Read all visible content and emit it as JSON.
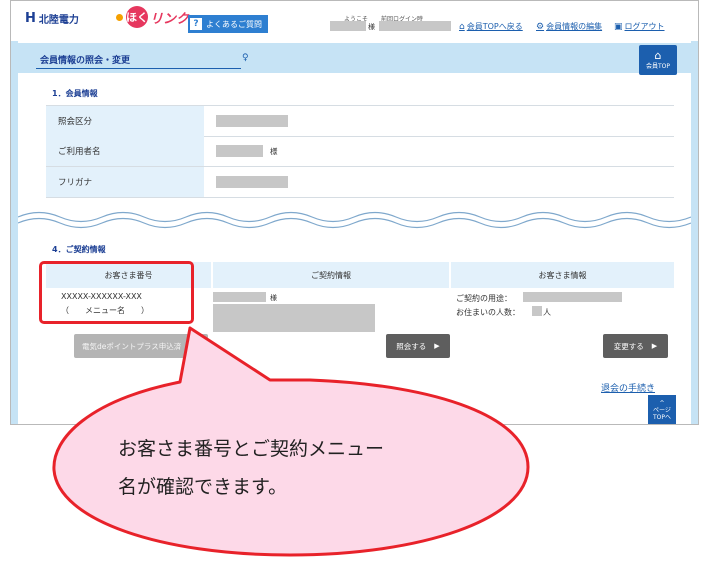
{
  "header": {
    "logo_mark": "H",
    "company": "北陸電力",
    "brand_circle": "ほく",
    "brand_text": "リンク",
    "faq_icon": "?",
    "faq_label": "よくあるご質問",
    "welcome_label": "ようこそ",
    "sama": "様",
    "prev_login_label": "前回ログイン時",
    "nav": [
      {
        "label": "会員TOPへ戻る",
        "icon": "home-icon"
      },
      {
        "label": "会員情報の編集",
        "icon": "gear-icon"
      },
      {
        "label": "ログアウト",
        "icon": "logout-icon"
      }
    ]
  },
  "titlebar": {
    "title": "会員情報の照会・変更",
    "top_button": "会員TOP"
  },
  "section1": {
    "heading": "1．会員情報",
    "rows": [
      {
        "label": "照会区分",
        "suffix": ""
      },
      {
        "label": "ご利用者名",
        "suffix": "様"
      },
      {
        "label": "フリガナ",
        "suffix": ""
      }
    ]
  },
  "section4": {
    "heading": "4．ご契約情報",
    "columns": [
      "お客さま番号",
      "ご契約情報",
      "お客さま情報"
    ],
    "customer_number": "XXXXX-XXXXXX-XXX",
    "menu_name": "（　　メニュー名　　）",
    "contract_sama": "様",
    "usage_label": "ご契約の用途：",
    "residents_label": "お住まいの人数：",
    "residents_unit": "人",
    "buttons": {
      "point_plus": "電気deポイントプラス申込済",
      "inquiry": "照会する",
      "change": "変更する"
    },
    "withdraw_link": "退会の手続き",
    "page_top": "ページTOPへ"
  },
  "callout": {
    "line1": "お客さま番号とご契約メニュー",
    "line2": "名が確認できます。"
  },
  "colors": {
    "brand_blue": "#1c3f94",
    "link_blue": "#1c5fae",
    "light_blue": "#c6e3f5",
    "highlight_red": "#e8222a",
    "callout_fill": "#fdd9e8"
  }
}
